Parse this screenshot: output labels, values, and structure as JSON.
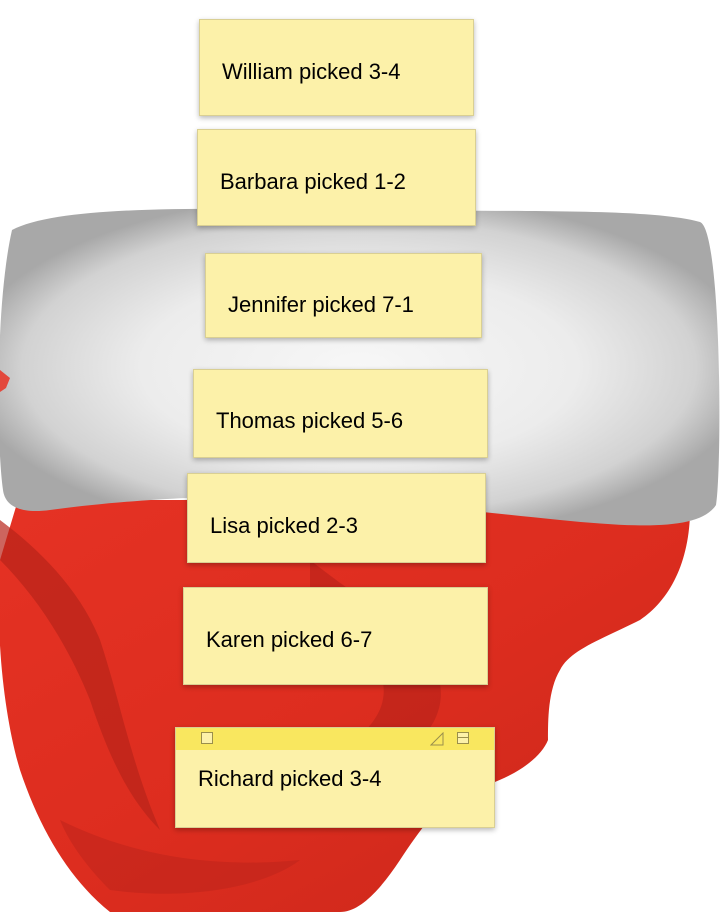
{
  "notes": [
    {
      "text": "William picked 3-4"
    },
    {
      "text": "Barbara picked 1-2"
    },
    {
      "text": "Jennifer picked 7-1"
    },
    {
      "text": "Thomas picked 5-6"
    },
    {
      "text": "Lisa picked 2-3"
    },
    {
      "text": "Karen picked 6-7"
    },
    {
      "text": "Richard picked 3-4"
    }
  ],
  "active_note": {
    "controls": [
      "close-icon",
      "resize-icon",
      "collapse-icon"
    ]
  },
  "colors": {
    "note_background": "#fcf1a9",
    "active_note_header": "#f9e75f",
    "hat_red": "#de2e1f",
    "hat_fur": "#e8e8e8"
  }
}
